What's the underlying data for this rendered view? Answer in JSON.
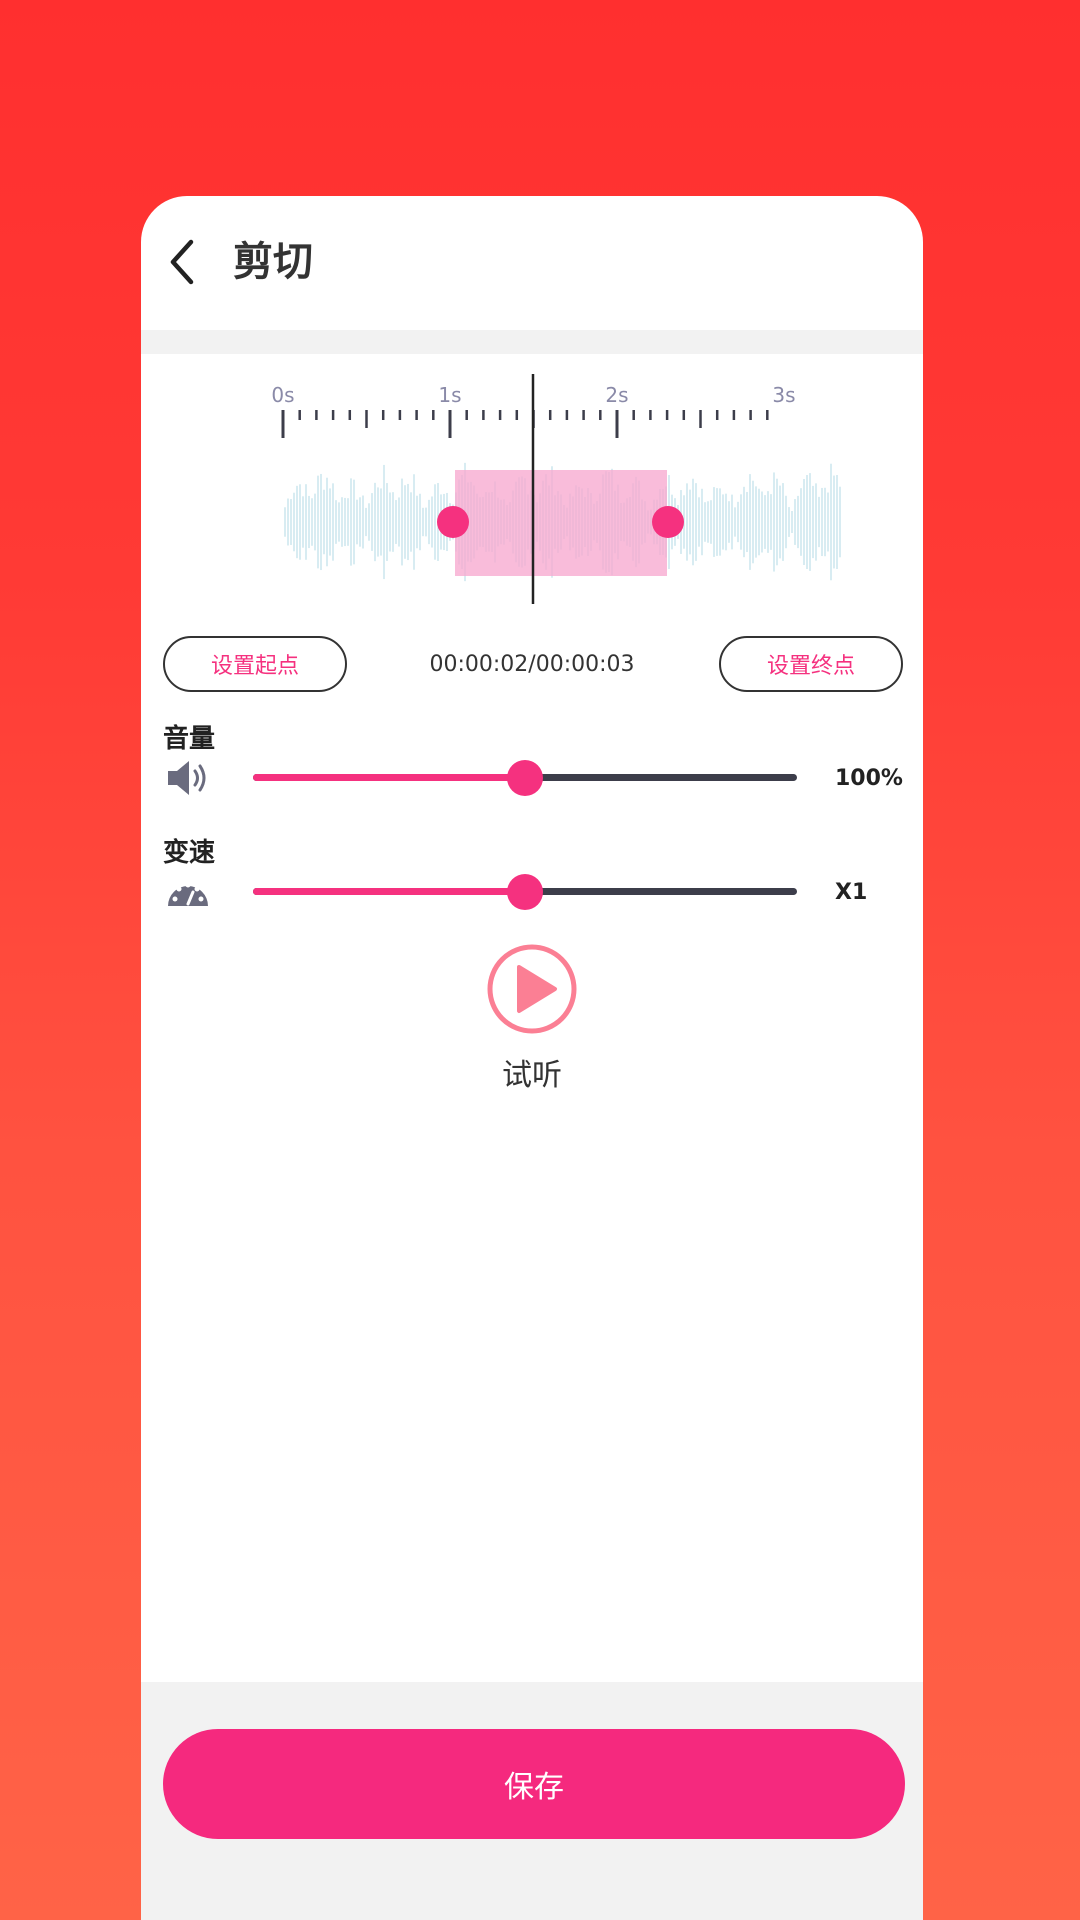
{
  "header": {
    "title": "剪切",
    "back_icon": "chevron-left-icon"
  },
  "timeline": {
    "tick_labels": [
      "0s",
      "1s",
      "2s",
      "3s"
    ],
    "set_start_label": "设置起点",
    "set_end_label": "设置终点",
    "time_readout": "00:00:02/00:00:03",
    "selection": {
      "start_fraction": 0.305,
      "end_fraction": 0.685
    },
    "playhead_fraction": 0.44
  },
  "volume": {
    "label": "音量",
    "value_text": "100%",
    "fraction": 0.5,
    "icon": "speaker-icon"
  },
  "speed": {
    "label": "变速",
    "value_text": "X1",
    "fraction": 0.5,
    "icon": "speedometer-icon"
  },
  "preview": {
    "label": "试听",
    "icon": "play-icon"
  },
  "save": {
    "label": "保存"
  },
  "colors": {
    "accent": "#f5317f",
    "save_button": "#f5297e",
    "waveform": "#cfe8ee",
    "selection": "#f7a6cd",
    "background_top": "#ff2f2f",
    "background_bottom": "#ff6347"
  }
}
